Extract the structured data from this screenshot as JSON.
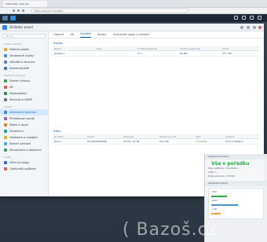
{
  "browser": {
    "tab_title": "Informační centrum",
    "url": "https://192.0.2.11:5001/"
  },
  "window": {
    "title": "Ovládací panel"
  },
  "sidebar": {
    "search_placeholder": "Hledat",
    "groups": [
      {
        "label": "Sdílení souborů",
        "items": [
          {
            "label": "Sdílená složka",
            "color": "#f0a623"
          },
          {
            "label": "Souborové služby",
            "color": "#4a90d9"
          },
          {
            "label": "Uživatel a skupina",
            "color": "#5b7ec9"
          },
          {
            "label": "Doména/LDAP",
            "color": "#3c77c2"
          }
        ]
      },
      {
        "label": "Možnosti připojení",
        "items": [
          {
            "label": "Externí přístup",
            "color": "#3fa34d"
          },
          {
            "label": "Síť",
            "color": "#e05a4d"
          },
          {
            "label": "Zabezpečení",
            "color": "#2d8f5f"
          },
          {
            "label": "Terminál a SNMP",
            "color": "#6b7785"
          }
        ]
      },
      {
        "label": "Systém",
        "items": [
          {
            "label": "Informační centrum",
            "color": "#2a8be3",
            "active": true
          },
          {
            "label": "Přihlašovací portál",
            "color": "#9b59b6"
          },
          {
            "label": "Místní a jazyk",
            "color": "#e67e22"
          },
          {
            "label": "Oznámení",
            "color": "#1fa1a8"
          },
          {
            "label": "Hardware a napájení",
            "color": "#e9a825"
          },
          {
            "label": "Externí zařízení",
            "color": "#4aa3df"
          },
          {
            "label": "Aktualizace a obnovení",
            "color": "#3b9b6c"
          }
        ]
      },
      {
        "label": "Služby",
        "items": [
          {
            "label": "Účet Synology",
            "color": "#2a6fd6"
          },
          {
            "label": "Oprávnění aplikace",
            "color": "#d95f5f"
          }
        ]
      }
    ]
  },
  "tabs": [
    {
      "label": "Obecné",
      "active": false
    },
    {
      "label": "Síť",
      "active": false
    },
    {
      "label": "Úložiště",
      "active": true
    },
    {
      "label": "Služba",
      "active": false
    },
    {
      "label": "Analytické údaje o zařízení",
      "active": false
    }
  ],
  "volume_section": {
    "title": "Svazek",
    "headers": [
      "Název",
      "Stav",
      "Využitá kapacita",
      "Celková kapacita",
      "Volná"
    ],
    "rows": [
      [
        "Svazek 1",
        "",
        "0 %",
        "50 MB",
        "35.7 TB"
      ]
    ]
  },
  "disk_section": {
    "title": "Disky",
    "headers": [
      "ID disku",
      "Model",
      "Kapacita",
      "Skladový fond",
      "Stav",
      "Alokace"
    ],
    "rows": [
      [
        "Disk 1",
        "ST18000NM000J",
        "16 TB / 18 TB",
        "16.4 TB",
        "V pořádku",
        "Fond úložiště 1"
      ]
    ]
  },
  "widget": {
    "header": "Systémové zdraví",
    "brand": "Vše v pořádku",
    "rows": [
      "Stav systému: V pořádku",
      "LAN 1: --",
      "Doba provozu: 0:05:44"
    ],
    "monitor_title": "Sledování zdrojů",
    "monitor_rows": [
      "CPU",
      "RAM",
      "LAN"
    ]
  },
  "watermark": "( Bazoš.cz"
}
